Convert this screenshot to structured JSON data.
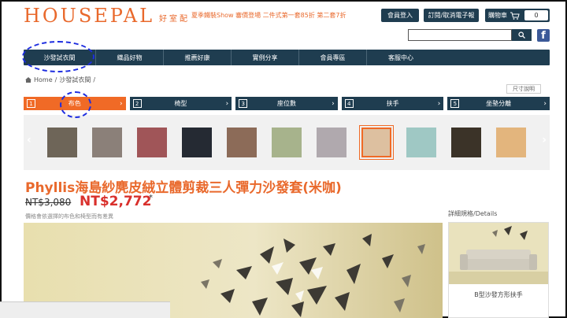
{
  "header": {
    "logo_text": "HOUSEPAL",
    "logo_sub": "好室配",
    "promo": "夏季鐵裝Show 審價登場 二件式第一套85折 第二套7折",
    "login_label": "會員登入",
    "order_label": "訂閱/取消電子報",
    "cart_label": "購物車",
    "cart_count": "0",
    "search_placeholder": "",
    "facebook_glyph": "f"
  },
  "nav": {
    "items": [
      "沙發試衣間",
      "織品好物",
      "推薦好康",
      "實例分享",
      "會員專區",
      "客服中心"
    ]
  },
  "breadcrumb": {
    "home": "Home",
    "sep": "/",
    "current": "沙發試衣間",
    "trail": "/"
  },
  "size_link": "尺寸說明",
  "steps": [
    {
      "num": "1",
      "label": "布色",
      "active": true
    },
    {
      "num": "2",
      "label": "椅型",
      "active": false
    },
    {
      "num": "3",
      "label": "座位數",
      "active": false
    },
    {
      "num": "4",
      "label": "扶手",
      "active": false
    },
    {
      "num": "5",
      "label": "坐墊分離",
      "active": false
    }
  ],
  "swatches": {
    "colors": [
      "#6e6558",
      "#8b8079",
      "#a05558",
      "#252a33",
      "#8c6b58",
      "#a7b38c",
      "#b0a9ae",
      "#ddc0a0",
      "#9fc8c4",
      "#3b3328",
      "#e3b57d"
    ],
    "selected_index": 7
  },
  "product": {
    "title": "Phyllis海島紗麂皮絨立體剪裁三人彈力沙發套(米咖)",
    "old_price": "NT$3,080",
    "new_price": "NT$2,772",
    "asterisk": "*",
    "note": "價格會依選擇的布色和椅型而有差異"
  },
  "details": {
    "label": "詳細規格/Details",
    "item_name": "B型沙發方形扶手"
  },
  "colors": {
    "navy": "#1f3d50",
    "orange": "#f06a26",
    "price_red": "#d9302c",
    "annotation": "#1d2de0"
  }
}
